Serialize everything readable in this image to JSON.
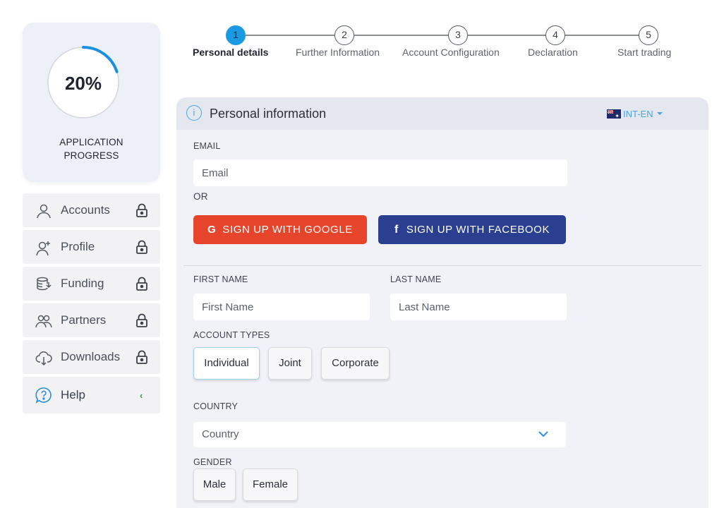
{
  "progress": {
    "value": 0.2,
    "label": "20%",
    "caption_line1": "APPLICATION",
    "caption_line2": "PROGRESS",
    "accent": "#1b8fe0"
  },
  "sidebar": {
    "items": [
      {
        "label": "Accounts",
        "icon": "user-icon",
        "locked": true
      },
      {
        "label": "Profile",
        "icon": "user-plus-icon",
        "locked": true
      },
      {
        "label": "Funding",
        "icon": "coins-icon",
        "locked": true
      },
      {
        "label": "Partners",
        "icon": "partners-icon",
        "locked": true
      },
      {
        "label": "Downloads",
        "icon": "cloud-download-icon",
        "locked": true
      },
      {
        "label": "Help",
        "icon": "help-icon",
        "chevron": "‹"
      }
    ]
  },
  "stepper": {
    "steps": [
      {
        "number": "1",
        "label": "Personal details",
        "active": true
      },
      {
        "number": "2",
        "label": "Further Information",
        "active": false
      },
      {
        "number": "3",
        "label": "Account Configuration",
        "active": false
      },
      {
        "number": "4",
        "label": "Declaration",
        "active": false
      },
      {
        "number": "5",
        "label": "Start trading",
        "active": false
      }
    ]
  },
  "form": {
    "title": "Personal information",
    "info_glyph": "i",
    "language": "INT-EN",
    "email_label": "EMAIL",
    "email_placeholder": "Email",
    "or_text": "OR",
    "google_button": "SIGN UP WITH GOOGLE",
    "google_glyph": "G",
    "facebook_button": "SIGN UP WITH FACEBOOK",
    "facebook_glyph": "f",
    "first_name_label": "FIRST NAME",
    "first_name_placeholder": "First Name",
    "last_name_label": "LAST NAME",
    "last_name_placeholder": "Last Name",
    "account_types_label": "ACCOUNT TYPES",
    "account_types": [
      "Individual",
      "Joint",
      "Corporate"
    ],
    "account_type_selected": "Individual",
    "country_label": "COUNTRY",
    "country_placeholder": "Country",
    "gender_label": "GENDER",
    "genders": [
      "Male",
      "Female"
    ]
  },
  "colors": {
    "google": "#e7452b",
    "facebook": "#2a3f8f",
    "step_active": "#1b9ae4",
    "link": "#4aa3e0"
  }
}
